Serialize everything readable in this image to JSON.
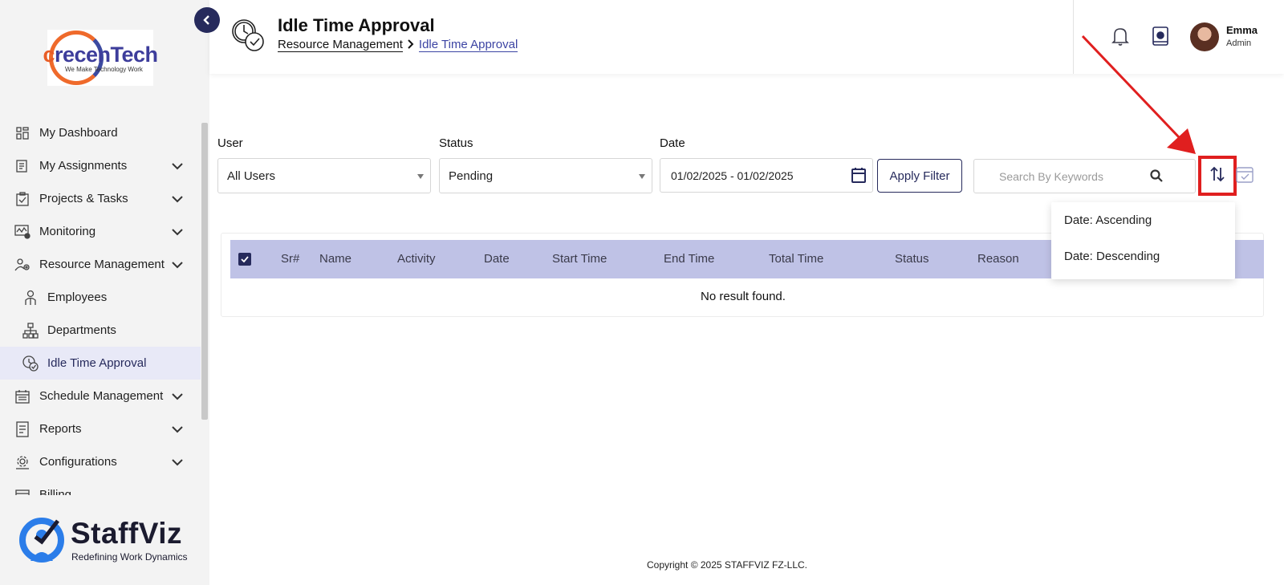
{
  "sidebar": {
    "logo": {
      "word_c": "c",
      "word_rest": "recenTech",
      "tagline": "We Make Technology Work"
    },
    "items": [
      {
        "label": "My Dashboard",
        "icon": "dashboard-icon"
      },
      {
        "label": "My Assignments",
        "icon": "assignments-icon"
      },
      {
        "label": "Projects & Tasks",
        "icon": "clipboard-icon"
      },
      {
        "label": "Monitoring",
        "icon": "monitoring-icon"
      },
      {
        "label": "Resource Management",
        "icon": "people-gear-icon"
      },
      {
        "label": "Employees",
        "icon": "employee-icon"
      },
      {
        "label": "Departments",
        "icon": "org-chart-icon"
      },
      {
        "label": "Idle Time Approval",
        "icon": "clock-check-icon"
      },
      {
        "label": "Schedule Management",
        "icon": "calendar-icon"
      },
      {
        "label": "Reports",
        "icon": "report-icon"
      },
      {
        "label": "Configurations",
        "icon": "config-icon"
      },
      {
        "label": "Billing",
        "icon": "billing-icon"
      }
    ],
    "brand": {
      "name": "StaffViz",
      "tagline": "Redefining Work Dynamics"
    }
  },
  "header": {
    "title": "Idle Time Approval",
    "breadcrumb": [
      "Resource Management",
      "Idle Time Approval"
    ],
    "user": {
      "name": "Emma",
      "role": "Admin"
    }
  },
  "filters": {
    "user": {
      "label": "User",
      "value": "All Users"
    },
    "status": {
      "label": "Status",
      "value": "Pending"
    },
    "date": {
      "label": "Date",
      "value": "01/02/2025 - 01/02/2025"
    },
    "apply_label": "Apply Filter",
    "search_placeholder": "Search By Keywords"
  },
  "sort_menu": {
    "options": [
      "Date: Ascending",
      "Date: Descending"
    ]
  },
  "table": {
    "columns": [
      "Sr#",
      "Name",
      "Activity",
      "Date",
      "Start Time",
      "End Time",
      "Total Time",
      "Status",
      "Reason"
    ],
    "empty_text": "No result found."
  },
  "footer": {
    "copyright": "Copyright © 2025 STAFFVIZ FZ-LLC."
  },
  "colors": {
    "primary": "#262a5c",
    "accent": "#3c44a3",
    "header_row": "#bfc2e6",
    "highlight": "#e01f1f"
  }
}
